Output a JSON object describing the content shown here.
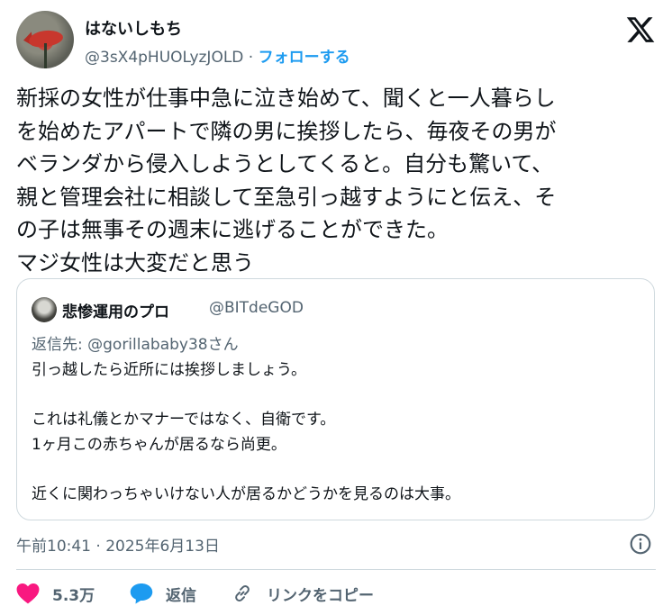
{
  "author": {
    "display_name": "はないしもち",
    "handle": "@3sX4pHUOLyzJOLD",
    "separator": " · ",
    "follow_label": "フォローする"
  },
  "brand": {
    "logo_icon": "x-logo-icon"
  },
  "tweet": {
    "lines": [
      "新採の女性が仕事中急に泣き始めて、聞くと一人暮らし",
      "を始めたアパートで隣の男に挨拶したら、毎夜その男が",
      "ベランダから侵入しようとしてくると。自分も驚いて、",
      "親と管理会社に相談して至急引っ越すようにと伝え、そ",
      "の子は無事その週末に逃げることができた。",
      "マジ女性は大変だと思う"
    ],
    "timestamp": "午前10:41 · 2025年6月13日"
  },
  "quoted": {
    "display_name": "悲惨運用のプロ",
    "handle": "@BITdeGOD",
    "reply_to": "返信先: @gorillababy38さん",
    "lines": [
      "引っ越したら近所には挨拶しましょう。",
      "",
      "これは礼儀とかマナーではなく、自衛です。",
      "1ヶ月この赤ちゃんが居るなら尚更。",
      "",
      "近くに関わっちゃいけない人が居るかどうかを見るのは大事。"
    ]
  },
  "actions": {
    "like_count": "5.3万",
    "reply_label": "返信",
    "copy_link_label": "リンクをコピー"
  },
  "colors": {
    "accent": "#1d9bf0",
    "like": "#f91880",
    "text": "#0f1419",
    "muted": "#536471",
    "border": "#cfd9de"
  }
}
